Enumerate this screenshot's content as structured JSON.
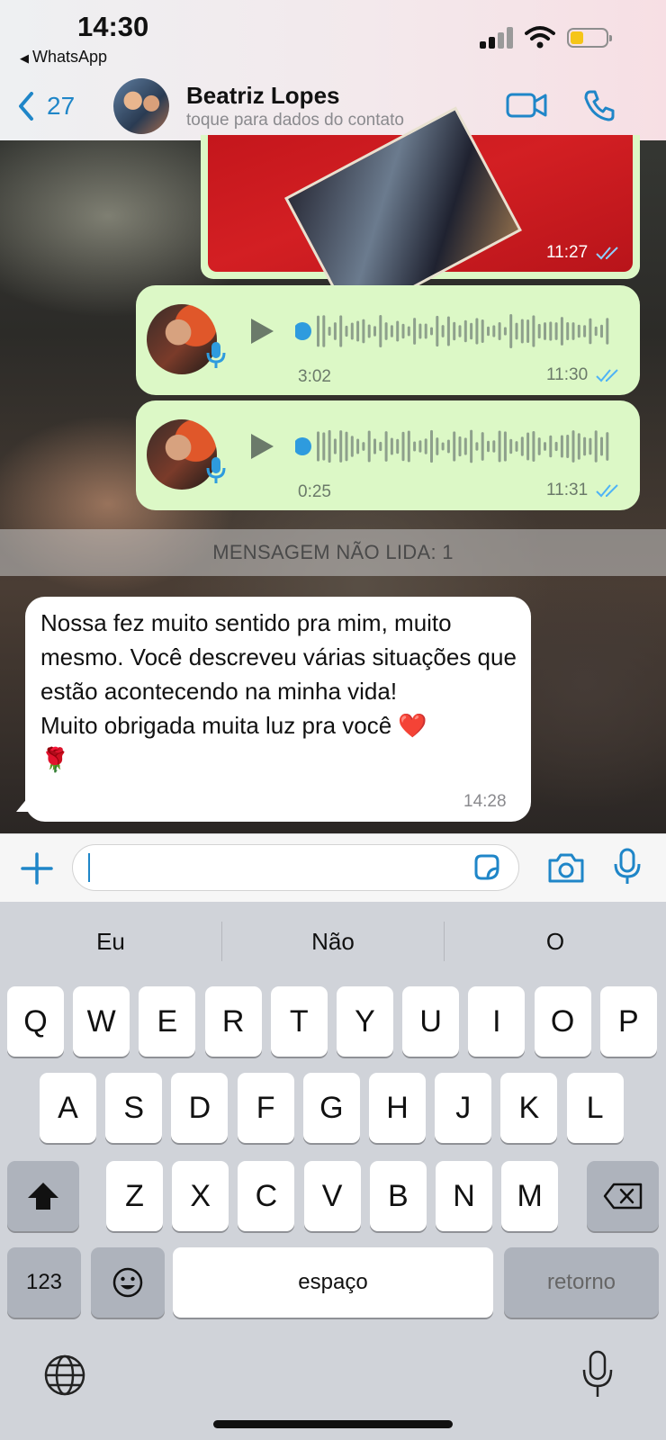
{
  "status_bar": {
    "time": "14:30",
    "back_app": "WhatsApp"
  },
  "header": {
    "back_count": "27",
    "contact_name": "Beatriz Lopes",
    "contact_subtitle": "toque para dados do contato",
    "video_icon": "video-camera-icon",
    "call_icon": "phone-icon"
  },
  "messages": {
    "image": {
      "time": "11:27"
    },
    "audio": [
      {
        "duration": "3:02",
        "time": "11:30",
        "progress": 0
      },
      {
        "duration": "0:25",
        "time": "11:31",
        "progress": 0
      }
    ],
    "unread_label": "MENSAGEM NÃO LIDA: 1",
    "incoming": {
      "text": "Nossa fez muito sentido pra mim, muito mesmo. Você descreveu várias situações que estão acontecendo na minha vida!\nMuito obrigada muita luz pra você ❤️\n🌹",
      "time": "14:28"
    }
  },
  "input": {
    "value": ""
  },
  "keyboard": {
    "suggestions": [
      "Eu",
      "Não",
      "O"
    ],
    "row1": [
      "Q",
      "W",
      "E",
      "R",
      "T",
      "Y",
      "U",
      "I",
      "O",
      "P"
    ],
    "row2": [
      "A",
      "S",
      "D",
      "F",
      "G",
      "H",
      "J",
      "K",
      "L"
    ],
    "row3": [
      "Z",
      "X",
      "C",
      "V",
      "B",
      "N",
      "M"
    ],
    "numbers_key": "123",
    "space_key": "espaço",
    "return_key": "retorno"
  },
  "colors": {
    "accent": "#1f86c8",
    "outgoing_bubble": "#dcf8c6",
    "read_ticks": "#4fb3f6"
  }
}
